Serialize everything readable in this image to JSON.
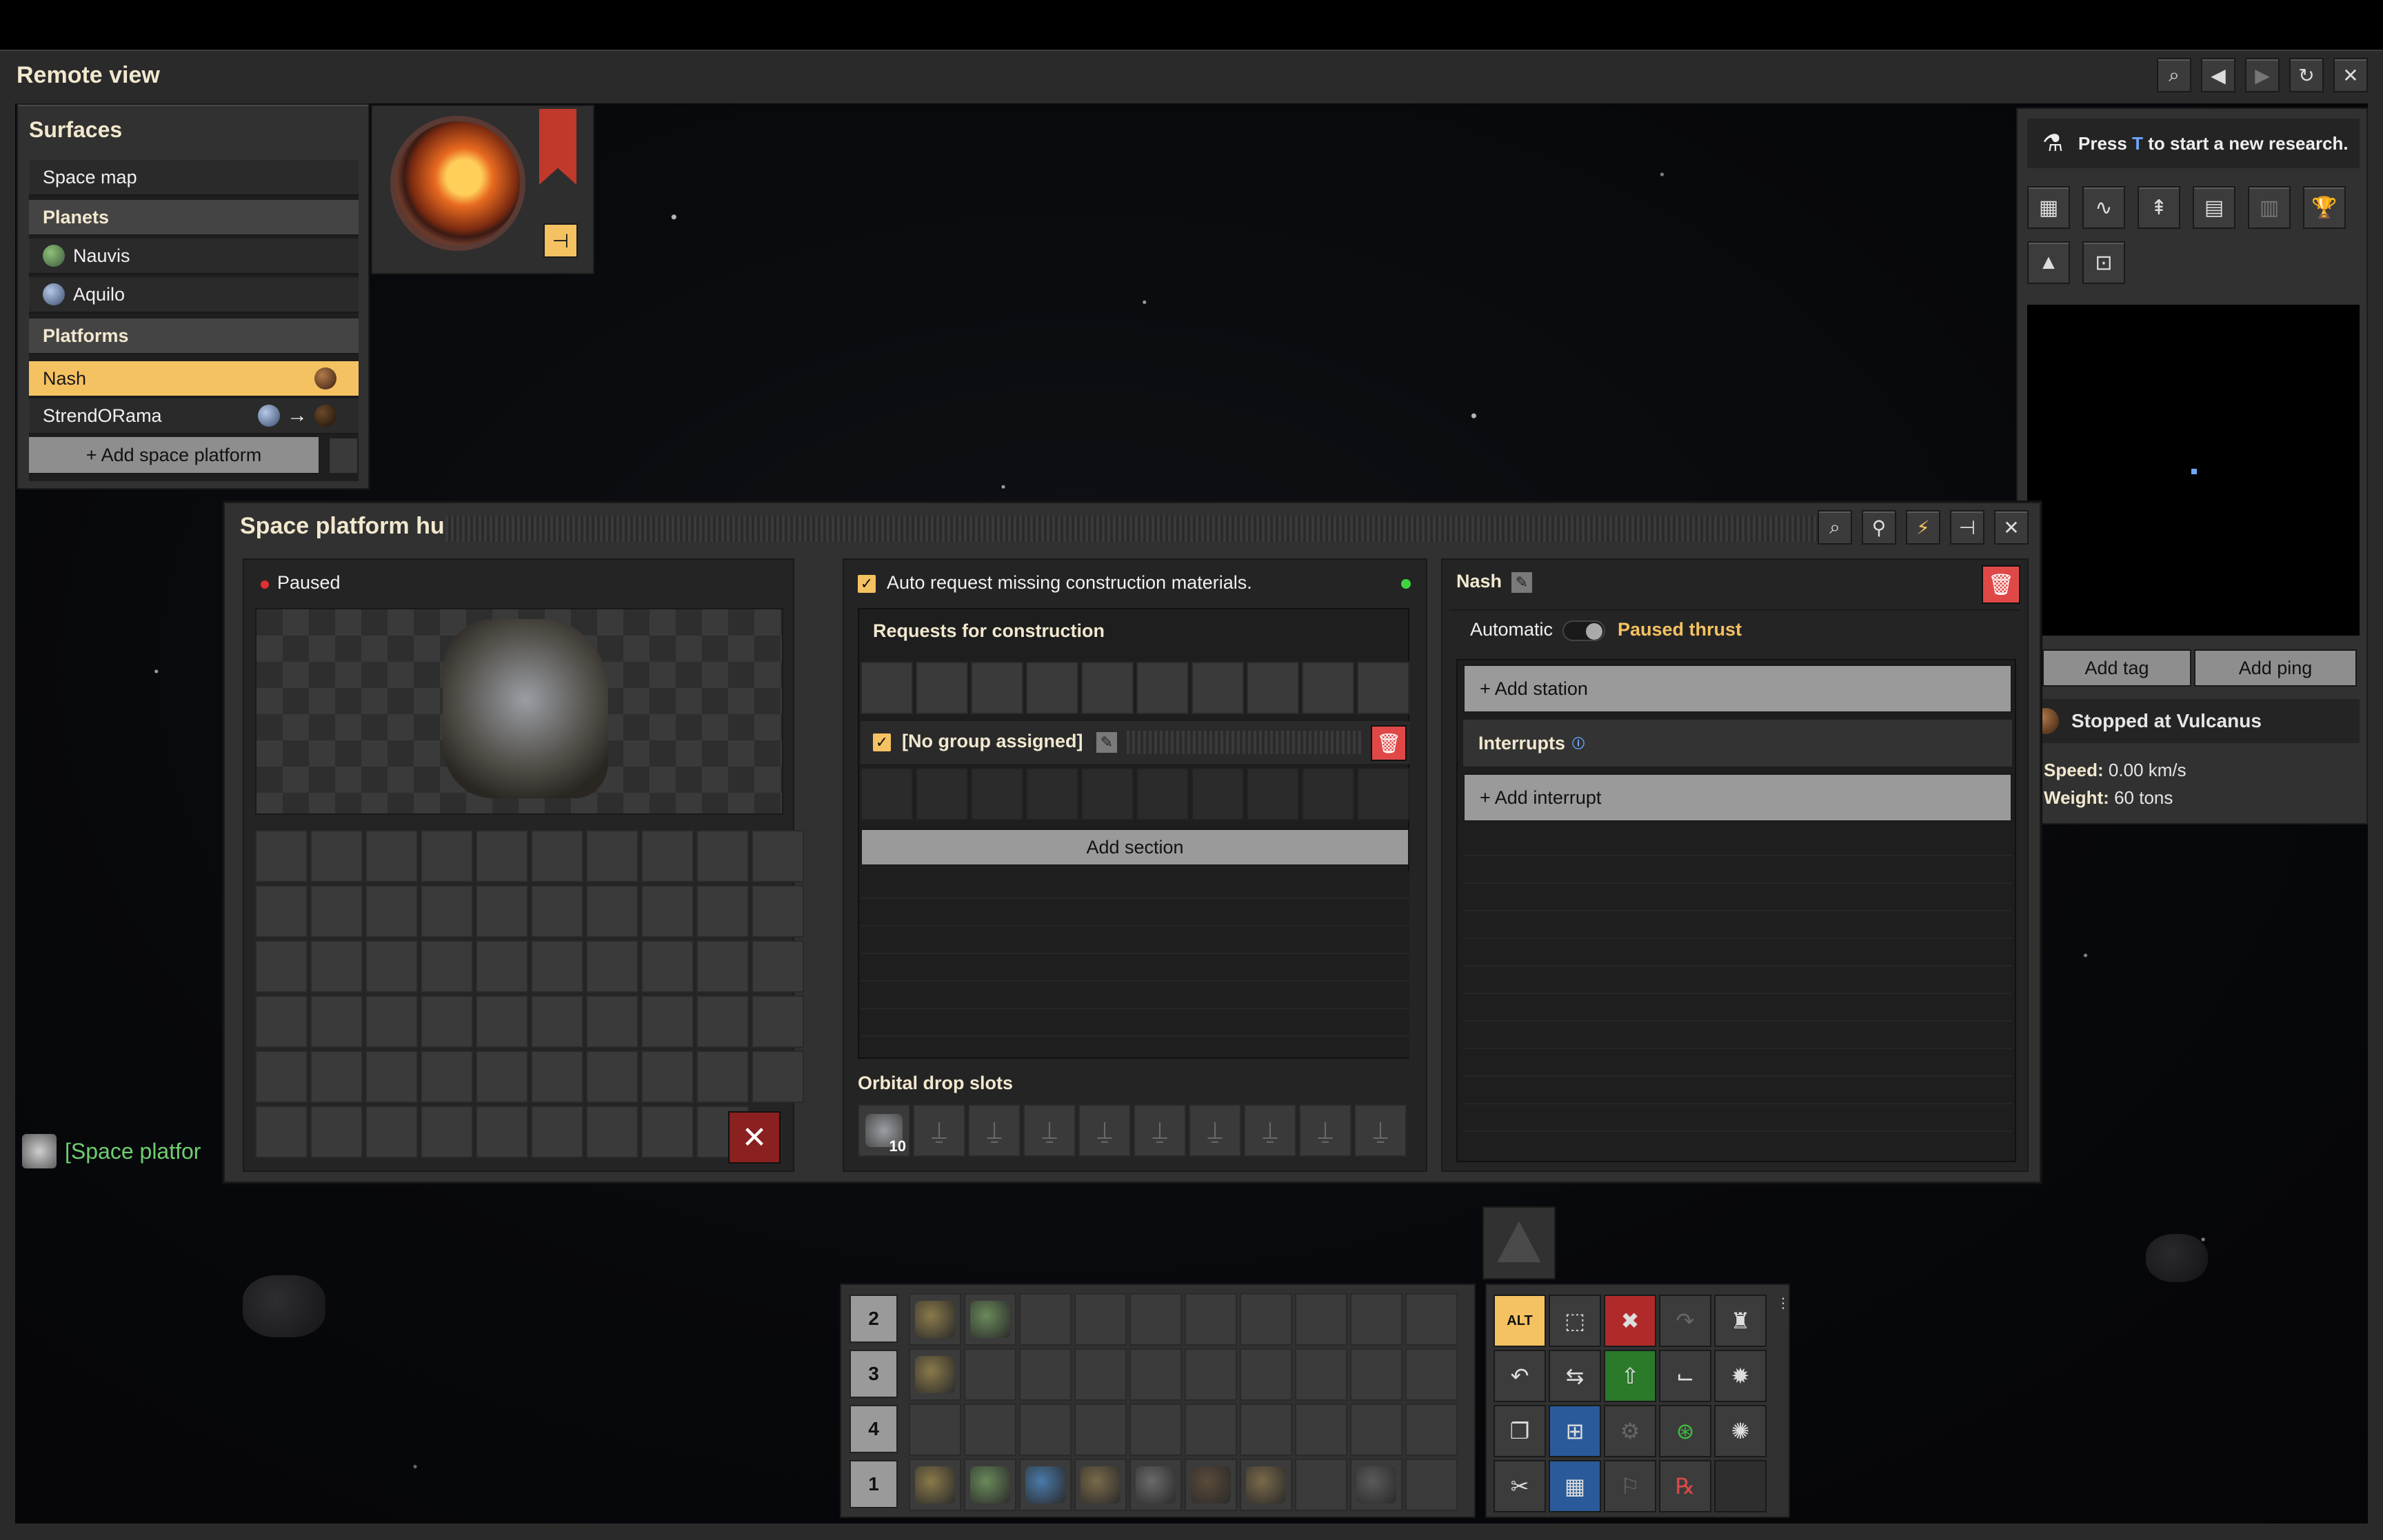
{
  "window": {
    "title": "Remote view"
  },
  "title_buttons": [
    "search-icon",
    "back-icon",
    "forward-icon",
    "refresh-icon",
    "close-icon"
  ],
  "surfaces": {
    "title": "Surfaces",
    "space_map": "Space map",
    "planets_header": "Planets",
    "planets": [
      "Nauvis",
      "Aquilo"
    ],
    "platforms_header": "Platforms",
    "platforms": [
      "Nash",
      "StrendORama"
    ],
    "add_button": "+ Add space platform"
  },
  "research": {
    "prefix": "Press ",
    "key": "T",
    "suffix": " to start a new research."
  },
  "map": {
    "add_tag": "Add tag",
    "add_ping": "Add ping",
    "status": "Stopped at Vulcanus",
    "speed_label": "Speed:",
    "speed_value": "0.00 km/s",
    "weight_label": "Weight:",
    "weight_value": "60 tons"
  },
  "chat_tag": "[Space platfor",
  "hub": {
    "title": "Space platform hub",
    "status": "Paused",
    "auto_request": "Auto request missing construction materials.",
    "requests_title": "Requests for construction",
    "group_label": "[No group assigned]",
    "add_section": "Add section",
    "orbital_title": "Orbital drop slots",
    "orbital_count": "10"
  },
  "schedule": {
    "platform_name": "Nash",
    "automatic": "Automatic",
    "paused_thrust": "Paused thrust",
    "add_station": "+ Add station",
    "interrupts": "Interrupts",
    "add_interrupt": "+ Add interrupt"
  },
  "quickbar": {
    "rows": [
      "2",
      "3",
      "4",
      "1"
    ]
  },
  "colors": {
    "accent": "#f5c262",
    "danger": "#e04848",
    "title": "#f2e8cf",
    "paused_thrust": "#f5c262"
  }
}
